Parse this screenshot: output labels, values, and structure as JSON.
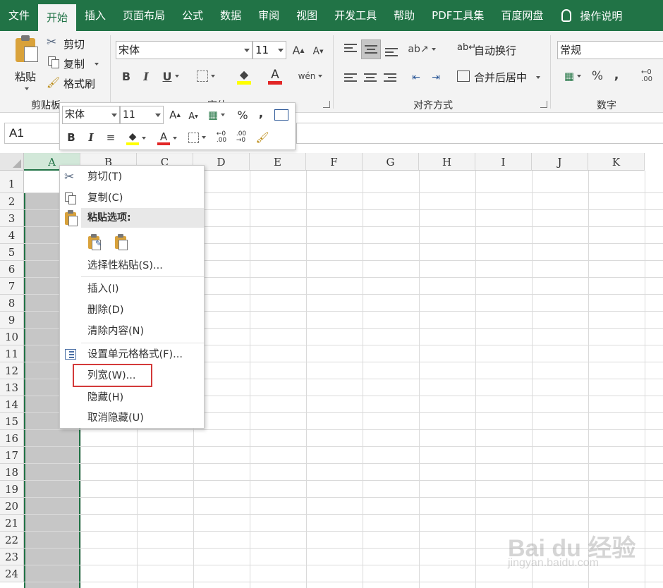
{
  "ribbon_tabs": [
    "文件",
    "开始",
    "插入",
    "页面布局",
    "公式",
    "数据",
    "审阅",
    "视图",
    "开发工具",
    "帮助",
    "PDF工具集",
    "百度网盘"
  ],
  "active_tab": "开始",
  "tell_me": "操作说明",
  "clipboard": {
    "paste": "粘贴",
    "cut": "剪切",
    "copy": "复制",
    "format_painter": "格式刷",
    "group_label": "剪贴板"
  },
  "font": {
    "name": "宋体",
    "size": "11",
    "group_label": "字体"
  },
  "alignment": {
    "wrap_text": "自动换行",
    "merge_center": "合并后居中",
    "group_label": "对齐方式"
  },
  "number": {
    "format": "常规",
    "group_label": "数字"
  },
  "name_box": "A1",
  "columns": [
    "A",
    "B",
    "C",
    "D",
    "E",
    "F",
    "G",
    "H",
    "I",
    "J",
    "K"
  ],
  "selected_column": "A",
  "rows": [
    "1",
    "2",
    "3",
    "4",
    "5",
    "6",
    "7",
    "8",
    "9",
    "10",
    "11",
    "12",
    "13",
    "14",
    "15",
    "16",
    "17",
    "18",
    "19",
    "20",
    "21",
    "22",
    "23",
    "24"
  ],
  "mini_toolbar": {
    "font": "宋体",
    "size": "11"
  },
  "context_menu": {
    "cut": "剪切(T)",
    "copy": "复制(C)",
    "paste_options": "粘贴选项:",
    "paste_special": "选择性粘贴(S)...",
    "insert": "插入(I)",
    "delete": "删除(D)",
    "clear_contents": "清除内容(N)",
    "format_cells": "设置单元格格式(F)...",
    "column_width": "列宽(W)...",
    "hide": "隐藏(H)",
    "unhide": "取消隐藏(U)"
  },
  "watermark": {
    "main": "Bai du 经验",
    "sub": "jingyan.baidu.com"
  },
  "colors": {
    "excel_green": "#217346",
    "highlight_red": "#d33a3a",
    "selected_column_fill": "#c6c6c6"
  }
}
